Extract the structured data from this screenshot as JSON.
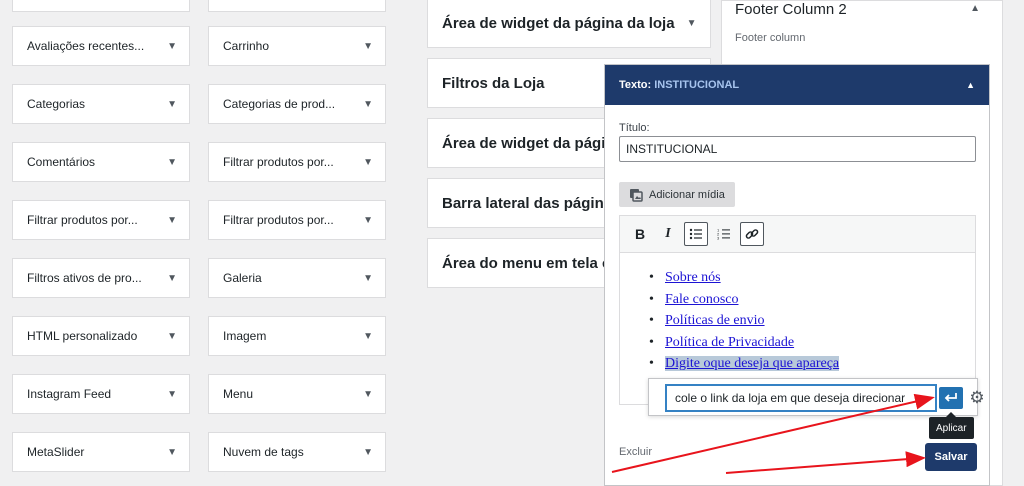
{
  "available_widgets": {
    "column1": [
      "",
      "Avaliações recentes...",
      "Categorias",
      "Comentários",
      "Filtrar produtos por...",
      "Filtros ativos de pro...",
      "HTML personalizado",
      "Instagram Feed",
      "MetaSlider"
    ],
    "column2": [
      "",
      "Carrinho",
      "Categorias de prod...",
      "Filtrar produtos por...",
      "Filtrar produtos por...",
      "Galeria",
      "Imagem",
      "Menu",
      "Nuvem de tags"
    ]
  },
  "widget_areas": [
    "Área de widget da página da loja",
    "Filtros da Loja",
    "Área de widget da página",
    "Barra lateral das páginas",
    "Área do menu em tela c"
  ],
  "footer_column": {
    "title": "Footer Column 2",
    "description": "Footer column"
  },
  "editor": {
    "header_label": "Texto:",
    "header_name": "INSTITUCIONAL",
    "title_label": "Título:",
    "title_value": "INSTITUCIONAL",
    "add_media_label": "Adicionar mídia",
    "toolbar": {
      "bold": "B",
      "italic": "I"
    },
    "list_items": [
      "Sobre nós",
      "Fale conosco",
      "Políticas de envio",
      "Política de Privacidade",
      "Digite oque deseja que apareça"
    ],
    "link_input_value": "cole o link da loja em que deseja direcionar",
    "apply_tooltip": "Aplicar",
    "delete_label": "Excluir",
    "save_label": "Salvar"
  },
  "colors": {
    "header_bg": "#1e3a6b",
    "apply_button": "#2271b1",
    "annotation_arrow": "#e8141c"
  }
}
